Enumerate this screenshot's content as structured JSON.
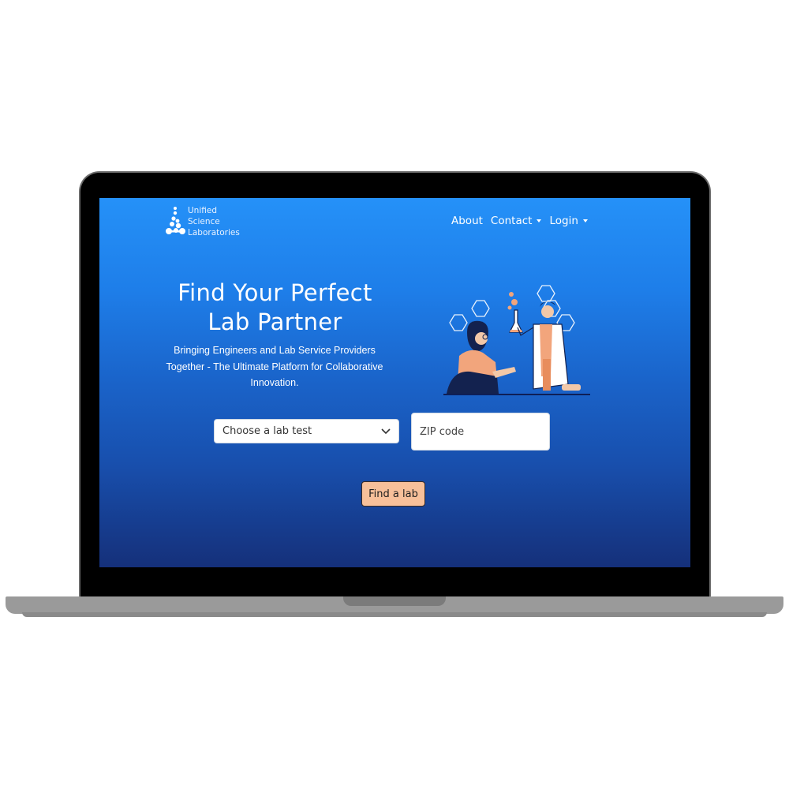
{
  "brand": {
    "lines": [
      "Unified",
      "Science",
      "Laboratories"
    ],
    "icon": "flask-molecule-logo"
  },
  "nav": {
    "about": "About",
    "contact": "Contact",
    "login": "Login"
  },
  "hero": {
    "title_line1": "Find Your Perfect",
    "title_line2": "Lab Partner",
    "subtitle": "Bringing Engineers and Lab Service Providers Together - The Ultimate Platform for Collaborative Innovation."
  },
  "form": {
    "lab_test_selected": "Choose a lab test",
    "zip_placeholder": "ZIP code",
    "submit_label": "Find a lab"
  },
  "colors": {
    "accent_button": "#f7c09a",
    "gradient_top": "#2591f8",
    "gradient_bottom": "#15307a"
  }
}
